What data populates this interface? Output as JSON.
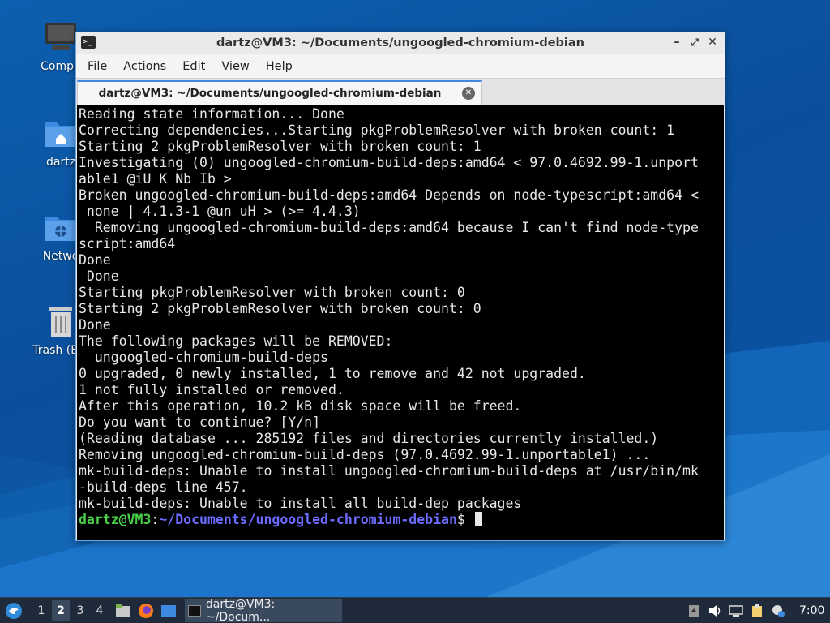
{
  "desktop": {
    "icons": [
      {
        "label": "Compu",
        "icon": "computer-icon"
      },
      {
        "label": "dartz",
        "icon": "home-folder-icon"
      },
      {
        "label": "Netwo",
        "icon": "network-folder-icon"
      },
      {
        "label": "Trash (Em",
        "icon": "trash-icon"
      }
    ]
  },
  "window": {
    "title": "dartz@VM3: ~/Documents/ungoogled-chromium-debian",
    "menu": [
      "File",
      "Actions",
      "Edit",
      "View",
      "Help"
    ],
    "tab": {
      "label": "dartz@VM3: ~/Documents/ungoogled-chromium-debian"
    }
  },
  "terminal": {
    "lines": [
      "Reading state information... Done",
      "Correcting dependencies...Starting pkgProblemResolver with broken count: 1",
      "Starting 2 pkgProblemResolver with broken count: 1",
      "Investigating (0) ungoogled-chromium-build-deps:amd64 < 97.0.4692.99-1.unport",
      "able1 @iU K Nb Ib >",
      "Broken ungoogled-chromium-build-deps:amd64 Depends on node-typescript:amd64 <",
      " none | 4.1.3-1 @un uH > (>= 4.4.3)",
      "  Removing ungoogled-chromium-build-deps:amd64 because I can't find node-type",
      "script:amd64",
      "Done",
      " Done",
      "Starting pkgProblemResolver with broken count: 0",
      "Starting 2 pkgProblemResolver with broken count: 0",
      "Done",
      "The following packages will be REMOVED:",
      "  ungoogled-chromium-build-deps",
      "0 upgraded, 0 newly installed, 1 to remove and 42 not upgraded.",
      "1 not fully installed or removed.",
      "After this operation, 10.2 kB disk space will be freed.",
      "Do you want to continue? [Y/n]",
      "(Reading database ... 285192 files and directories currently installed.)",
      "Removing ungoogled-chromium-build-deps (97.0.4692.99-1.unportable1) ...",
      "mk-build-deps: Unable to install ungoogled-chromium-build-deps at /usr/bin/mk",
      "-build-deps line 457.",
      "mk-build-deps: Unable to install all build-dep packages"
    ],
    "prompt": {
      "user": "dartz@VM3",
      "sep": ":",
      "path": "~/Documents/ungoogled-chromium-debian",
      "symbol": "$ "
    }
  },
  "taskbar": {
    "workspaces": [
      "1",
      "2",
      "3",
      "4"
    ],
    "active_workspace": "2",
    "task_label": "dartz@VM3: ~/Docum...",
    "clock": "7:00"
  },
  "colors": {
    "prompt_user": "#4ad14a",
    "prompt_path": "#6b6bff",
    "accent": "#3d8ae0"
  }
}
